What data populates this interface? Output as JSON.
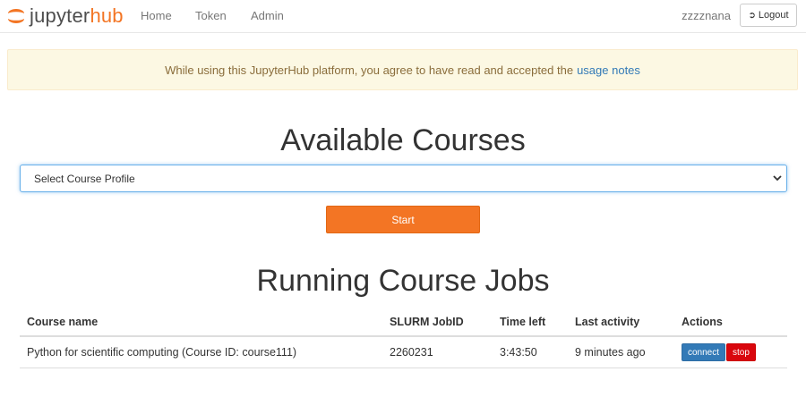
{
  "navbar": {
    "brand_part1": "jupyter",
    "brand_part2": "hub",
    "links": [
      "Home",
      "Token",
      "Admin"
    ],
    "user": "zzzznana",
    "logout_label": "Logout",
    "logout_icon": "sign-out-icon"
  },
  "alert": {
    "text": "While using this JupyterHub platform, you agree to have read and accepted the",
    "link_text": "usage notes"
  },
  "courses": {
    "title": "Available Courses",
    "select_value": "Select Course Profile",
    "start_label": "Start"
  },
  "jobs": {
    "title": "Running Course Jobs",
    "headers": [
      "Course name",
      "SLURM JobID",
      "Time left",
      "Last activity",
      "Actions"
    ],
    "rows": [
      {
        "course": "Python for scientific computing (Course ID: course111)",
        "job_id": "2260231",
        "time_left": "3:43:50",
        "last_activity": "9 minutes ago",
        "connect_label": "connect",
        "stop_label": "stop"
      }
    ]
  },
  "colors": {
    "brand_orange": "#f37524",
    "link_blue": "#337ab7",
    "stop_red": "#d9070e",
    "alert_bg": "#fcf8e3"
  }
}
